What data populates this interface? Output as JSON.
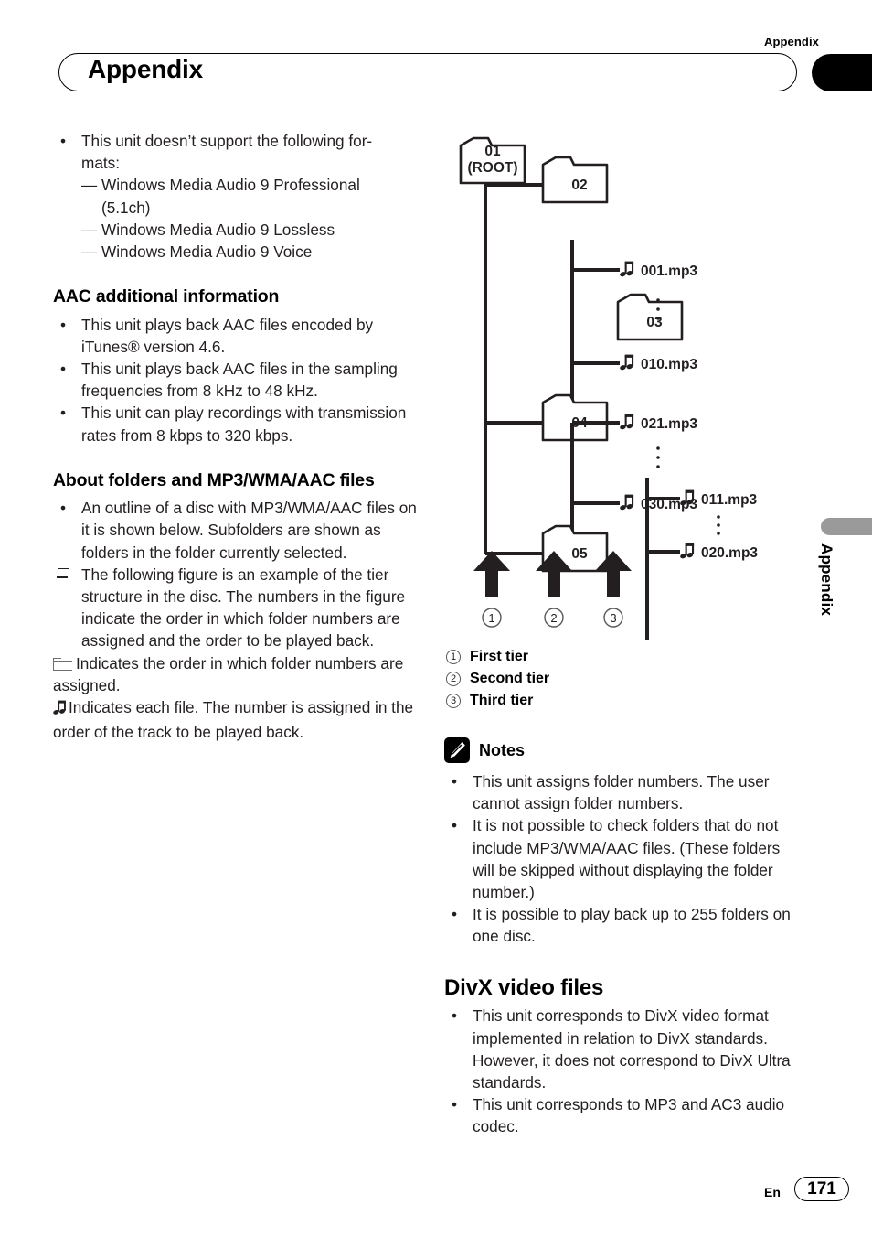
{
  "page": {
    "running_head": "Appendix",
    "chapter_title": "Appendix",
    "side_tab_label": "Appendix",
    "language_code": "En",
    "page_number": "171"
  },
  "left_column": {
    "unsupported": {
      "bullet": "This unit doesn’t support the following for-",
      "bullet_cont": "mats:",
      "items": [
        "Windows Media Audio 9 Professional",
        "(5.1ch)",
        "Windows Media Audio 9 Lossless",
        "Windows Media Audio 9 Voice"
      ],
      "dash": "—"
    },
    "aac_section": {
      "heading": "AAC additional information",
      "bullets": [
        "This unit plays back AAC files encoded by iTunes® version 4.6.",
        "This unit plays back AAC files in the sampling frequencies from 8 kHz to 48 kHz.",
        "This unit can play recordings with transmission rates from 8 kbps to 320 kbps."
      ]
    },
    "folders_section": {
      "heading": "About folders and MP3/WMA/AAC files",
      "bullet1": "An outline of a disc with MP3/WMA/AAC files on it is shown below. Subfolders are shown as folders in the folder currently selected.",
      "square_note": "The following figure is an example of the tier structure in the disc. The numbers in the figure indicate the order in which folder numbers are assigned and the order to be played back.",
      "folder_legend": "Indicates the order in which folder numbers are assigned.",
      "file_legend": "Indicates each file. The number is assigned in the order of the track to be played back."
    }
  },
  "tree_figure": {
    "root": {
      "line1": "01",
      "line2": "(ROOT)"
    },
    "folders": [
      {
        "label": "02",
        "tier": 2
      },
      {
        "label": "03",
        "tier": 3
      },
      {
        "label": "04",
        "tier": 2
      },
      {
        "label": "05",
        "tier": 2
      }
    ],
    "files": [
      {
        "label": "001.mp3",
        "parent": "02"
      },
      {
        "label": "010.mp3",
        "parent": "02"
      },
      {
        "label": "011.mp3",
        "parent": "03"
      },
      {
        "label": "020.mp3",
        "parent": "03"
      },
      {
        "label": "021.mp3",
        "parent": "04"
      },
      {
        "label": "030.mp3",
        "parent": "04"
      }
    ],
    "ellipsis": "⋮",
    "arrow_markers": [
      "1",
      "2",
      "3"
    ]
  },
  "tier_legend": [
    {
      "num": "1",
      "label": "First tier"
    },
    {
      "num": "2",
      "label": "Second tier"
    },
    {
      "num": "3",
      "label": "Third tier"
    }
  ],
  "notes": {
    "heading": "Notes",
    "items": [
      "This unit assigns folder numbers. The user cannot assign folder numbers.",
      "It is not possible to check folders that do not include MP3/WMA/AAC files. (These folders will be skipped without displaying the folder number.)",
      "It is possible to play back up to 255 folders on one disc."
    ]
  },
  "divx_section": {
    "heading": "DivX video files",
    "bullets": [
      "This unit corresponds to DivX video format implemented in relation to DivX standards. However, it does not correspond to DivX Ultra standards.",
      "This unit corresponds to MP3 and AC3 audio codec."
    ]
  },
  "bullet_char": "•"
}
